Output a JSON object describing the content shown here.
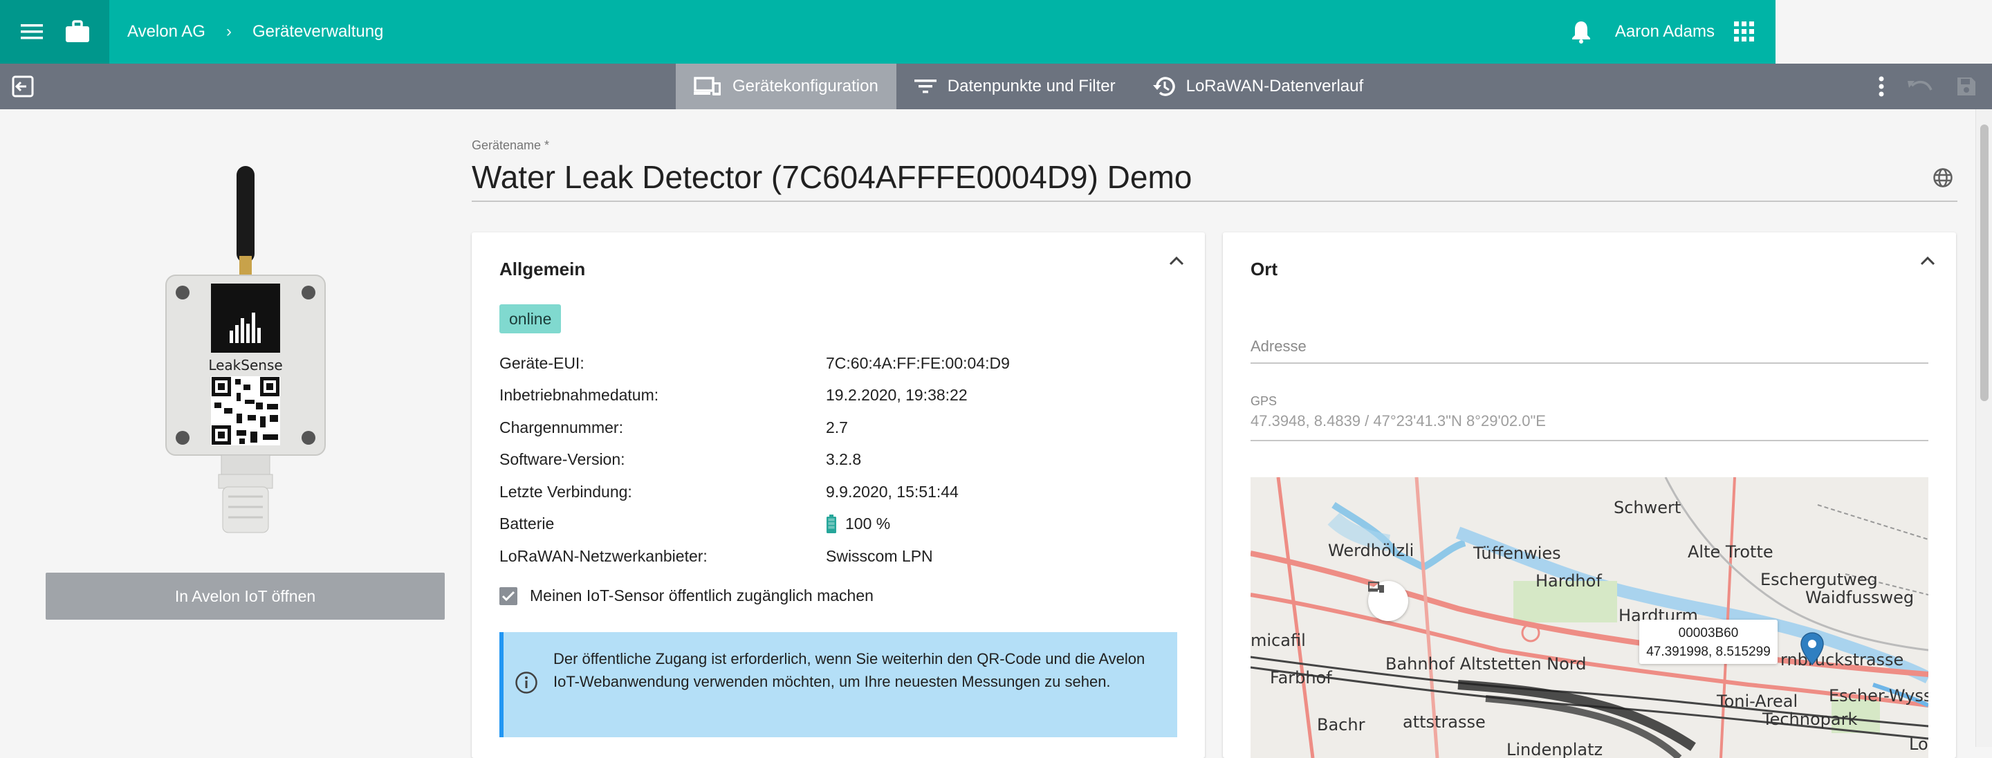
{
  "topbar": {
    "breadcrumb": [
      "Avelon AG",
      "Geräteverwaltung"
    ],
    "breadcrumb_separator": "›",
    "user_name": "Aaron Adams",
    "accent_color": "#00b4a6",
    "icons": [
      "menu-icon",
      "briefcase-icon",
      "bell-icon",
      "apps-grid-icon"
    ]
  },
  "toolbar": {
    "tabs": [
      {
        "label": "Gerätekonfiguration",
        "icon": "devices-icon",
        "active": true
      },
      {
        "label": "Datenpunkte und Filter",
        "icon": "filter-icon",
        "active": false
      },
      {
        "label": "LoRaWAN-Datenverlauf",
        "icon": "history-icon",
        "active": false
      }
    ],
    "icons": [
      "exit-icon",
      "more-vert-icon",
      "undo-icon",
      "save-icon"
    ]
  },
  "left": {
    "device_brand": "LeakSense",
    "open_button": "In Avelon IoT öffnen"
  },
  "device_name": {
    "label": "Gerätename *",
    "value": "Water Leak Detector (7C604AFFFE0004D9) Demo"
  },
  "general": {
    "title": "Allgemein",
    "status": "online",
    "rows": [
      {
        "key": "Geräte-EUI:",
        "value": "7C:60:4A:FF:FE:00:04:D9"
      },
      {
        "key": "Inbetriebnahmedatum:",
        "value": "19.2.2020, 19:38:22"
      },
      {
        "key": "Chargennummer:",
        "value": "2.7"
      },
      {
        "key": "Software-Version:",
        "value": "3.2.8"
      },
      {
        "key": "Letzte Verbindung:",
        "value": "9.9.2020, 15:51:44"
      },
      {
        "key": "Batterie",
        "value": "100 %"
      },
      {
        "key": "LoRaWAN-Netzwerkanbieter:",
        "value": "Swisscom LPN"
      }
    ],
    "battery_level": 1.0,
    "public_checkbox": {
      "label": "Meinen IoT-Sensor öffentlich zugänglich machen",
      "checked": true
    },
    "info_text": "Der öffentliche Zugang ist erforderlich, wenn Sie weiterhin den QR-Code und die Avelon IoT-Webanwendung verwenden möchten, um Ihre neuesten Messungen zu sehen."
  },
  "location": {
    "title": "Ort",
    "address_label": "Adresse",
    "address_value": "",
    "gps_label": "GPS",
    "gps_value": "47.3948, 8.4839  /  47°23'41.3\"N 8°29'02.0\"E",
    "map_labels": [
      "Schwert",
      "Werdhölzli",
      "Tüffenwies",
      "Alte Trotte",
      "Hardhof",
      "Eschergutweg",
      "Waidfussweg",
      "Hardturm",
      "micafil",
      "Farbhof",
      "Bahnhof Altstetten Nord",
      "rnbruckstrasse",
      "Toni-Areal",
      "Escher-Wyss",
      "Technopark",
      "Bachr",
      "attstrasse",
      "Lindenplatz",
      "Lo"
    ],
    "popup": {
      "id": "00003B60",
      "coords": "47.391998,  8.515299"
    }
  }
}
